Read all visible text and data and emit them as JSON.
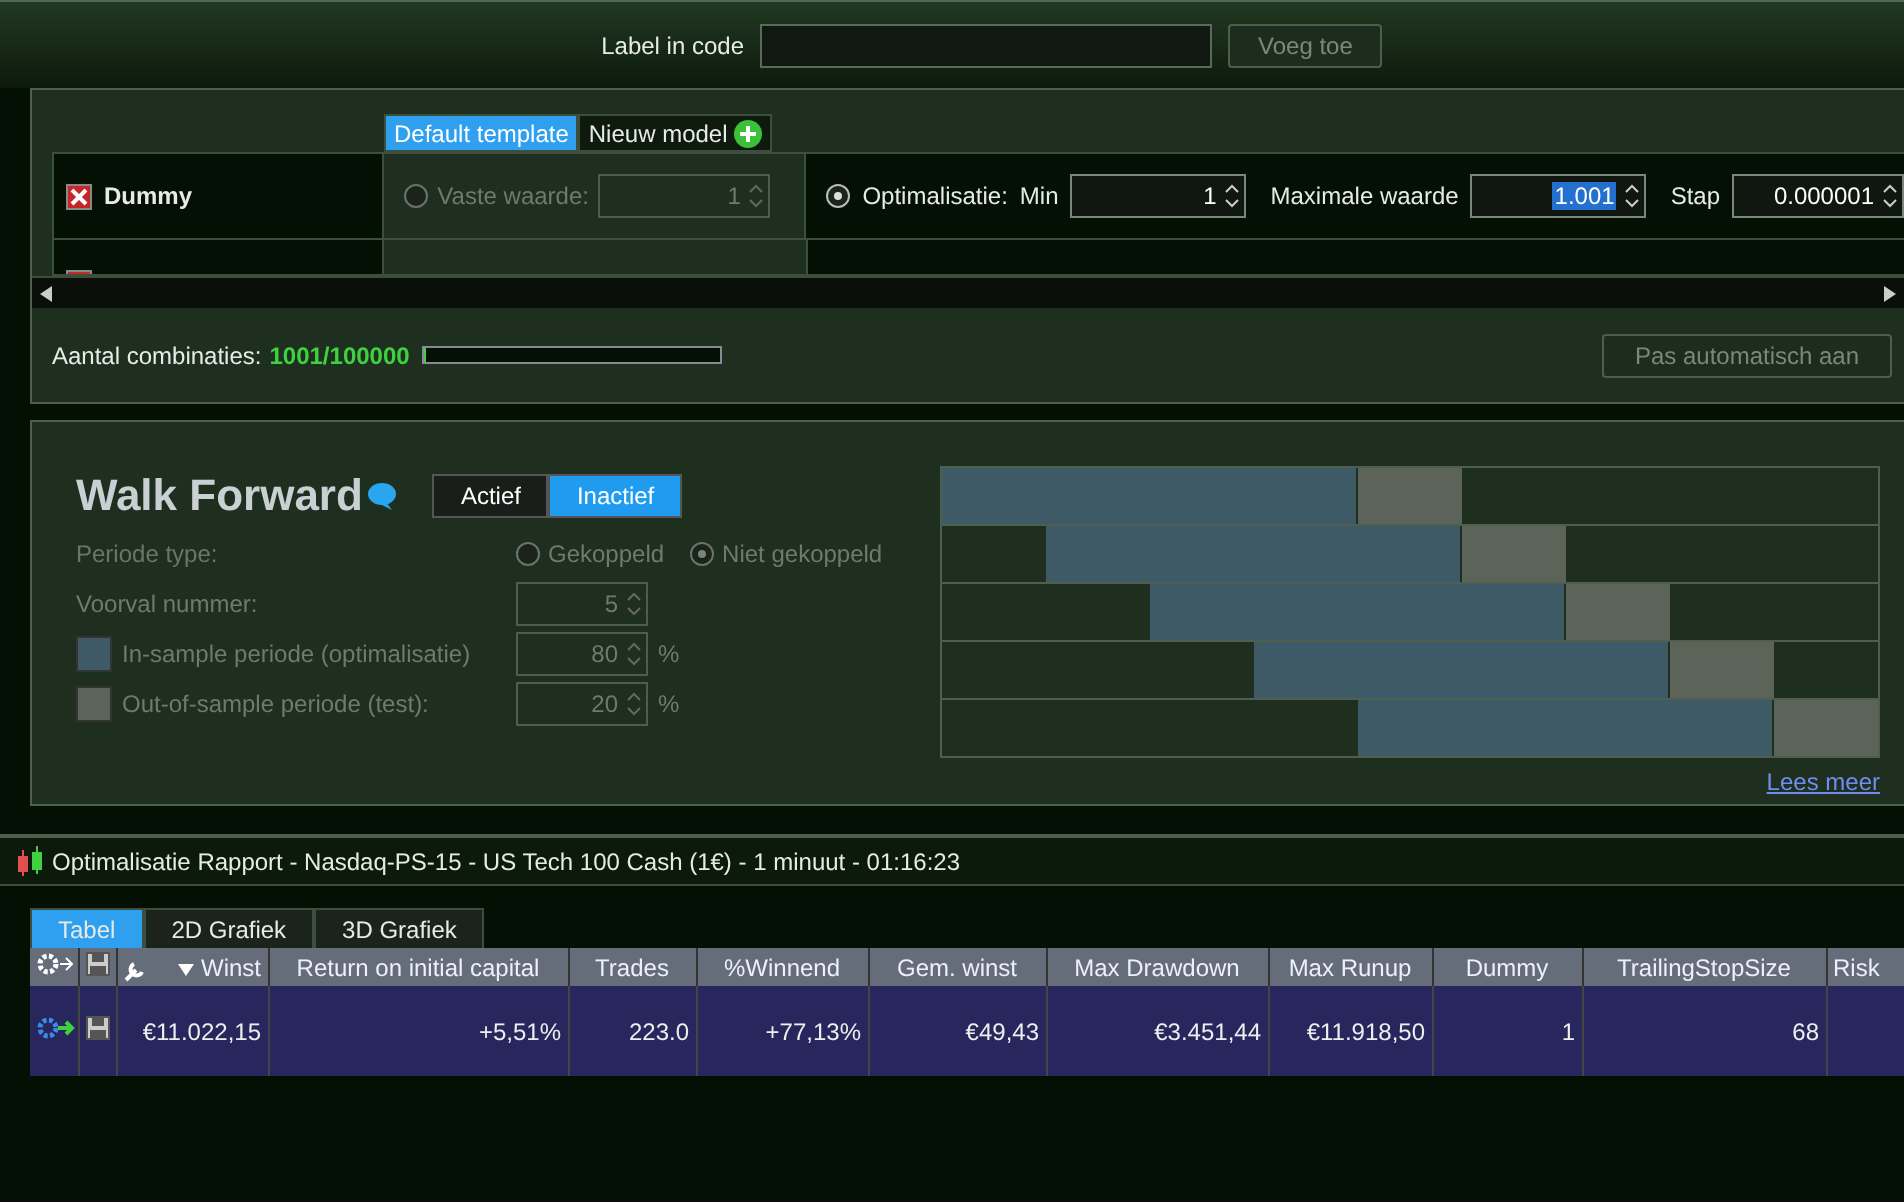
{
  "toolbar": {
    "label": "Label in code",
    "button": {
      "label": "Voeg toe",
      "disabled": true
    }
  },
  "parameters": {
    "tabs": [
      {
        "label": "Default template",
        "selected": true
      },
      {
        "label": "Nieuw model",
        "selected": false
      }
    ],
    "rows": [
      {
        "name": "Dummy",
        "checked": true,
        "fixed": {
          "label": "Vaste waarde:",
          "selected": false,
          "value": "1"
        },
        "optimize": {
          "label": "Optimalisatie:",
          "selected": true,
          "min_label": "Min",
          "min": "1",
          "max_label": "Maximale waarde",
          "max": "1.001",
          "step_label": "Stap",
          "step": "0.000001"
        }
      },
      {
        "checked": true
      }
    ],
    "combinations": {
      "label": "Aantal combinaties:",
      "value": "1001/100000",
      "level": 0.01
    },
    "auto_button": {
      "label": "Pas automatisch aan",
      "disabled": true
    }
  },
  "walk_forward": {
    "title": "Walk Forward",
    "disabled": true,
    "tabs": [
      {
        "label": "Actief",
        "selected": false
      },
      {
        "label": "Inactief",
        "selected": true
      }
    ],
    "period_type": {
      "label": "Periode type:",
      "options": [
        {
          "label": "Gekoppeld",
          "selected": false
        },
        {
          "label": "Niet gekoppeld",
          "selected": true
        }
      ]
    },
    "fields": [
      {
        "label": "Voorval nummer:",
        "value": "5"
      },
      {
        "label": "In-sample periode (optimalisatie)",
        "value": "80",
        "unit": "%",
        "color": "#3d5a66"
      },
      {
        "label": "Out-of-sample periode (test):",
        "value": "20",
        "unit": "%",
        "color": "#5c6459"
      }
    ],
    "link": "Lees meer"
  },
  "report": {
    "title": "Optimalisatie Rapport - Nasdaq-PS-15 - US Tech 100 Cash (1€) - 1 minuut - 01:16:23",
    "tabs": [
      {
        "label": "Tabel",
        "selected": true
      },
      {
        "label": "2D Grafiek",
        "selected": false
      },
      {
        "label": "3D Grafiek",
        "selected": false
      }
    ],
    "columns": [
      {
        "label": "Winst",
        "sorted": true
      },
      {
        "label": "Return on initial capital",
        "sorted": false
      },
      {
        "label": "Trades",
        "sorted": false
      },
      {
        "label": "%Winnend",
        "sorted": false
      },
      {
        "label": "Gem. winst",
        "sorted": false
      },
      {
        "label": "Max Drawdown",
        "sorted": false
      },
      {
        "label": "Max Runup",
        "sorted": false
      },
      {
        "label": "Dummy",
        "sorted": false
      },
      {
        "label": "TrailingStopSize",
        "sorted": false
      },
      {
        "label": "Risk",
        "sorted": false
      }
    ],
    "rows": [
      {
        "selected": true,
        "cells": [
          "€11.022,15",
          "+5,51%",
          "223.0",
          "+77,13%",
          "€49,43",
          "€3.451,44",
          "€11.918,50",
          "1",
          "68",
          ""
        ]
      }
    ]
  }
}
